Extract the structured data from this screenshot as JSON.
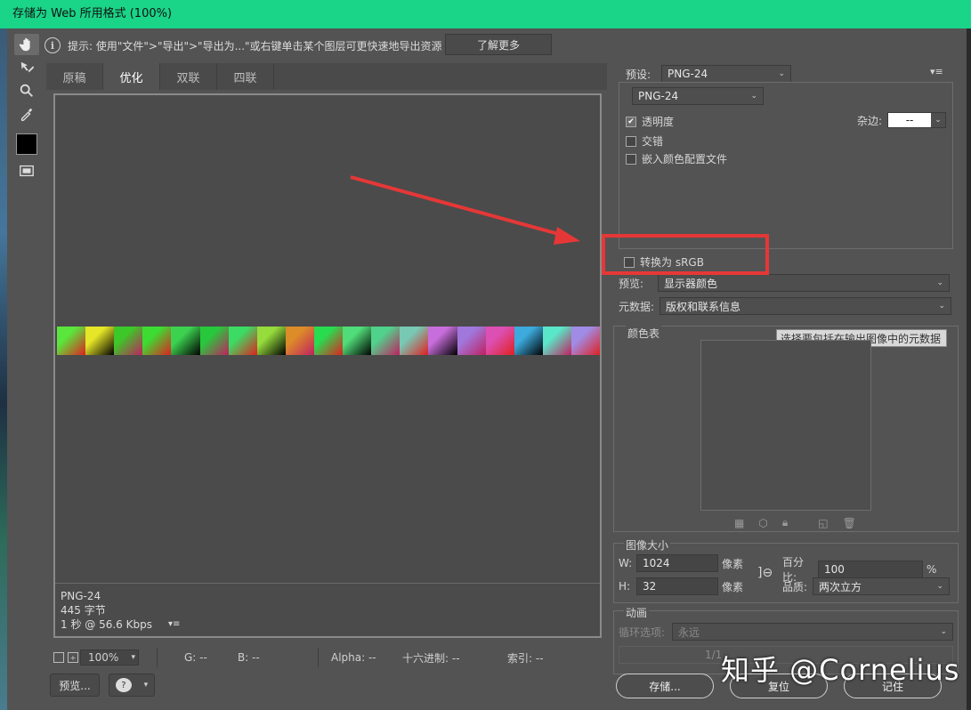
{
  "window": {
    "title": "存储为 Web 所用格式 (100%)"
  },
  "hint": {
    "text": "提示: 使用\"文件\">\"导出\">\"导出为...\"或右键单击某个图层可更快速地导出资源",
    "learn_more": "了解更多"
  },
  "tabs": [
    "原稿",
    "优化",
    "双联",
    "四联"
  ],
  "canvas": {
    "format": "PNG-24",
    "size": "445 字节",
    "speed": "1 秒 @ 56.6 Kbps"
  },
  "status": {
    "zoom": "100%",
    "g": "G: --",
    "b": "B: --",
    "alpha": "Alpha: --",
    "hex": "十六进制: --",
    "index": "索引: --"
  },
  "buttons": {
    "preview": "预览...",
    "save": "存储...",
    "reset": "复位",
    "remember": "记住"
  },
  "settings": {
    "preset_label": "预设:",
    "preset_value": "PNG-24",
    "format_value": "PNG-24",
    "transparency": "透明度",
    "matte_label": "杂边:",
    "matte_value": "--",
    "interlaced": "交错",
    "embed_profile": "嵌入颜色配置文件",
    "convert_srgb": "转换为 sRGB",
    "preview_label": "预览:",
    "preview_value": "显示器颜色",
    "metadata_label": "元数据:",
    "metadata_value": "版权和联系信息",
    "color_table": "颜色表",
    "tooltip": "选择要包括在输出图像中的元数据"
  },
  "image_size": {
    "title": "图像大小",
    "w_label": "W:",
    "w_value": "1024",
    "w_unit": "像素",
    "h_label": "H:",
    "h_value": "32",
    "h_unit": "像素",
    "percent_label": "百分比:",
    "percent_value": "100",
    "percent_unit": "%",
    "quality_label": "品质:",
    "quality_value": "两次立方"
  },
  "animation": {
    "title": "动画",
    "loop_label": "循环选项:",
    "loop_value": "永远",
    "frame": "1/1"
  },
  "watermark": "知乎 @Cornelius",
  "colors": {
    "titlebar": "#1ad488",
    "highlight": "#e63737",
    "arrow": "#e63737"
  }
}
